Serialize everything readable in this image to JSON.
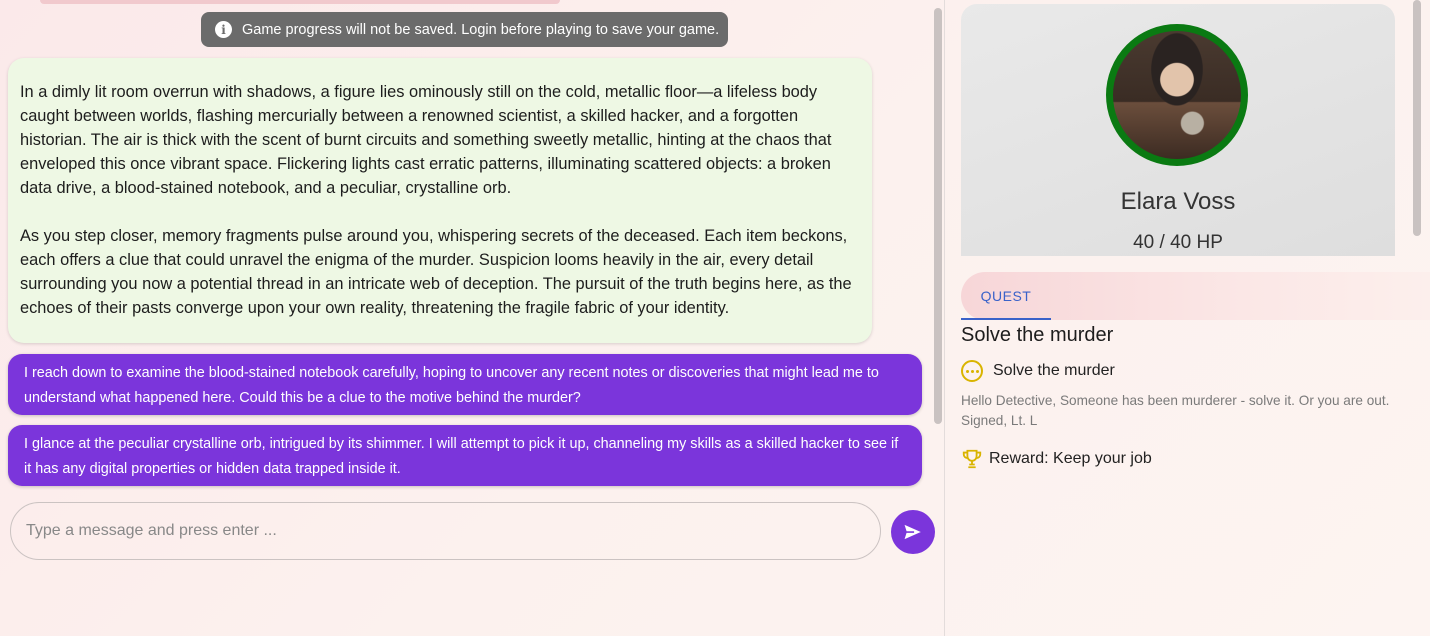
{
  "notice": {
    "icon": "info-icon",
    "text": "Game progress will not be saved. Login before playing to save your game."
  },
  "narration": {
    "paragraphs": [
      "In a dimly lit room overrun with shadows, a figure lies ominously still on the cold, metallic floor—a lifeless body caught between worlds, flashing mercurially between a renowned scientist, a skilled hacker, and a forgotten historian. The air is thick with the scent of burnt circuits and something sweetly metallic, hinting at the chaos that enveloped this once vibrant space. Flickering lights cast erratic patterns, illuminating scattered objects: a broken data drive, a blood-stained notebook, and a peculiar, crystalline orb.",
      "As you step closer, memory fragments pulse around you, whispering secrets of the deceased. Each item beckons, each offers a clue that could unravel the enigma of the murder. Suspicion looms heavily in the air, every detail surrounding you now a potential thread in an intricate web of deception. The pursuit of the truth begins here, as the echoes of their pasts converge upon your own reality, threatening the fragile fabric of your identity."
    ]
  },
  "messages": [
    "I reach down to examine the blood-stained notebook carefully, hoping to uncover any recent notes or discoveries that might lead me to understand what happened here. Could this be a clue to the motive behind the murder?",
    "I glance at the peculiar crystalline orb, intrigued by its shimmer. I will attempt to pick it up, channeling my skills as a skilled hacker to see if it has any digital properties or hidden data trapped inside it."
  ],
  "composer": {
    "placeholder": "Type a message and press enter ...",
    "value": "",
    "send_icon": "send-icon"
  },
  "character": {
    "name": "Elara Voss",
    "hp": "40 / 40 HP",
    "hp_current": 40,
    "hp_max": 40,
    "ring_color": "#0a7a12"
  },
  "tabs": {
    "quest_label": "QUEST"
  },
  "quest": {
    "title": "Solve the murder",
    "objective": "Solve the murder",
    "objective_icon": "ellipsis-circle-icon",
    "description": "Hello Detective, Someone has been murderer - solve it. Or you are out. Signed, Lt. L",
    "reward": "Reward: Keep your job",
    "reward_icon": "trophy-icon"
  },
  "colors": {
    "accent": "#7b35db",
    "narration_bg": "#eef8e4",
    "notice_bg": "#6b6b6b",
    "tab_active": "#3a62c9",
    "icon_gold": "#d9b400"
  }
}
